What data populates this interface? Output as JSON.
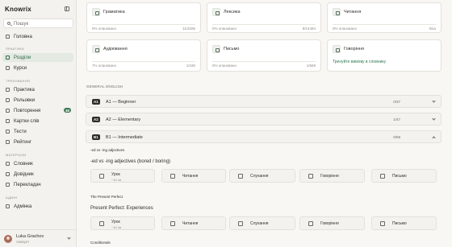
{
  "app": {
    "logo_text": "Knowrix"
  },
  "sidebar": {
    "search_placeholder": "Пошук",
    "sections": {
      "practice": "Практика",
      "training": "Тренування",
      "materials": "Матеріали",
      "admin": "Адмін"
    },
    "items": {
      "home": "Головна",
      "sections_item": "Розділи",
      "courses": "Курси",
      "practice_item": "Практика",
      "roleplays": "Рольовки",
      "reviews": "Повторення",
      "reviews_badge": "46",
      "flashcards": "Картки слів",
      "tests": "Тести",
      "rating": "Рейтинг",
      "dictionary": "Словник",
      "reference": "Довідник",
      "translator": "Перекладач",
      "admin_panel": "Адмінка"
    },
    "user": {
      "name": "Luka Grachov",
      "role": "Аккаунт"
    }
  },
  "skills": [
    {
      "title": "Граматика",
      "percent": "0% опановано",
      "count": "11/3286"
    },
    {
      "title": "Лексика",
      "percent": "0% опановано",
      "count": "8/14494"
    },
    {
      "title": "Читання",
      "percent": "0% опановано",
      "count": "0/ка"
    },
    {
      "title": "Аудіювання",
      "percent": "7% опановано",
      "count": "1/180"
    },
    {
      "title": "Письмо",
      "percent": "0% опановано",
      "count": "1/569"
    },
    {
      "title": "Говоріння",
      "link": "Тренуйте вимову в словнику"
    }
  ],
  "section_heading": "GENERAL ENGLISH",
  "levels": [
    {
      "code": "A1",
      "name": "A1 — Beginner",
      "ratio": "0/37"
    },
    {
      "code": "A2",
      "name": "A2 — Elementary",
      "ratio": "1/47"
    },
    {
      "code": "B1",
      "name": "B1 — Intermediate",
      "ratio": "0/58"
    }
  ],
  "subsections": {
    "first": "-ed vs -ing adjectives",
    "first_topic": "-ed vs -ing adjectives (bored / boring)",
    "second": "The Present Perfect",
    "second_topic": "Present Perfect: Experiences",
    "third": "Conditionals"
  },
  "activities": {
    "lesson": "Урок",
    "lesson_time": "~10 хв",
    "reading": "Читання",
    "listening": "Слухання",
    "speaking": "Говоріння",
    "writing": "Письмо"
  }
}
